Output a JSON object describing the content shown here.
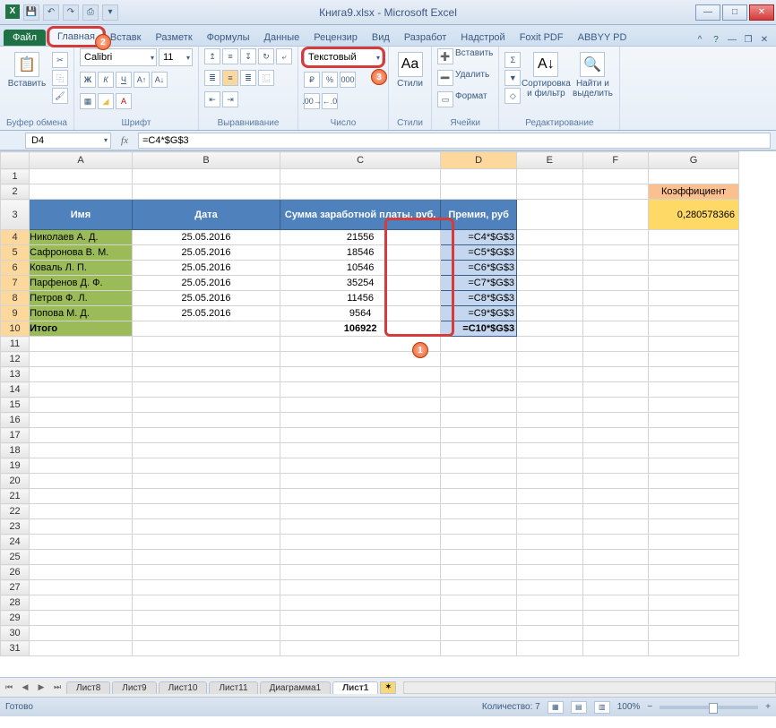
{
  "title": "Книга9.xlsx - Microsoft Excel",
  "tabs": {
    "file": "Файл",
    "items": [
      "Главная",
      "Вставк",
      "Разметк",
      "Формулы",
      "Данные",
      "Рецензир",
      "Вид",
      "Разработ",
      "Надстрой",
      "Foxit PDF",
      "ABBYY PD"
    ]
  },
  "ribbon": {
    "clipboard": {
      "paste": "Вставить",
      "label": "Буфер обмена"
    },
    "font": {
      "name": "Calibri",
      "size": "11",
      "label": "Шрифт"
    },
    "align": {
      "label": "Выравнивание"
    },
    "number": {
      "format": "Текстовый",
      "label": "Число"
    },
    "styles": {
      "label": "Стили"
    },
    "cells": {
      "insert": "Вставить",
      "delete": "Удалить",
      "format": "Формат",
      "label": "Ячейки"
    },
    "editing": {
      "sort": "Сортировка и фильтр",
      "find": "Найти и выделить",
      "label": "Редактирование"
    }
  },
  "formulabar": {
    "name": "D4",
    "formula": "=C4*$G$3"
  },
  "columns": [
    "A",
    "B",
    "C",
    "D",
    "E",
    "F",
    "G"
  ],
  "sheetdata": {
    "coef_label": "Коэффициент",
    "coef_value": "0,280578366",
    "headers": [
      "Имя",
      "Дата",
      "Сумма заработной платы, руб.",
      "Премия, руб"
    ],
    "rows": [
      {
        "n": "4",
        "name": "Николаев А. Д.",
        "date": "25.05.2016",
        "sum": "21556",
        "bonus": "=C4*$G$3"
      },
      {
        "n": "5",
        "name": "Сафронова В. М.",
        "date": "25.05.2016",
        "sum": "18546",
        "bonus": "=C5*$G$3"
      },
      {
        "n": "6",
        "name": "Коваль Л. П.",
        "date": "25.05.2016",
        "sum": "10546",
        "bonus": "=C6*$G$3"
      },
      {
        "n": "7",
        "name": "Парфенов Д. Ф.",
        "date": "25.05.2016",
        "sum": "35254",
        "bonus": "=C7*$G$3"
      },
      {
        "n": "8",
        "name": "Петров Ф. Л.",
        "date": "25.05.2016",
        "sum": "11456",
        "bonus": "=C8*$G$3"
      },
      {
        "n": "9",
        "name": "Попова М. Д.",
        "date": "25.05.2016",
        "sum": "9564",
        "bonus": "=C9*$G$3"
      }
    ],
    "totals": {
      "n": "10",
      "label": "Итого",
      "sum": "106922",
      "bonus": "=C10*$G$3"
    }
  },
  "sheets": [
    "Лист8",
    "Лист9",
    "Лист10",
    "Лист11",
    "Диаграмма1",
    "Лист1"
  ],
  "statusbar": {
    "ready": "Готово",
    "count_label": "Количество:",
    "count": "7",
    "zoom": "100%"
  }
}
